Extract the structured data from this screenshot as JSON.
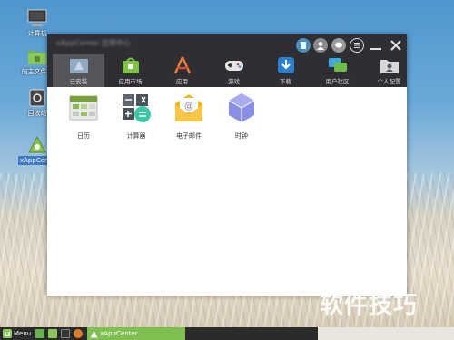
{
  "desktop": {
    "icons": [
      {
        "label": "计算机",
        "icon": "computer-icon"
      },
      {
        "label": "的主文件夹",
        "icon": "home-folder-icon"
      },
      {
        "label": "回收站",
        "icon": "trash-icon"
      },
      {
        "label": "xAppCenter",
        "icon": "xappcenter-icon"
      }
    ]
  },
  "window": {
    "title": "xAppCenter 应用中心",
    "controls": [
      "skin-icon",
      "user-icon",
      "chat-icon",
      "menu-icon",
      "minimize-icon",
      "close-icon"
    ],
    "tabs": [
      {
        "label": "已安装",
        "icon": "installed-icon"
      },
      {
        "label": "应用市场",
        "icon": "market-icon"
      },
      {
        "label": "应用",
        "icon": "apps-icon"
      },
      {
        "label": "游戏",
        "icon": "gamepad-icon"
      },
      {
        "label": "下载",
        "icon": "download-icon"
      },
      {
        "label": "用户社区",
        "icon": "community-icon"
      },
      {
        "label": "个人配置",
        "icon": "profile-icon"
      }
    ],
    "active_tab": "已安装",
    "apps": [
      {
        "label": "日历",
        "icon": "calendar-icon"
      },
      {
        "label": "计算器",
        "icon": "calculator-icon"
      },
      {
        "label": "电子邮件",
        "icon": "email-icon"
      },
      {
        "label": "时钟",
        "icon": "clock-icon"
      }
    ]
  },
  "taskbar": {
    "menu_label": "Menu",
    "task_label": "xAppCenter"
  },
  "watermark": "软件技巧",
  "colors": {
    "titlebar": "#2f2f33",
    "active_tab": "#55565b",
    "taskbar": "#2b2b2b",
    "task_highlight": "#7fbf52"
  }
}
